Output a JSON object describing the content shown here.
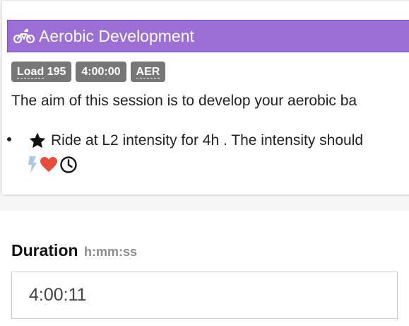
{
  "workout": {
    "title": "Aerobic Development",
    "header_color": "#9b6fd6",
    "header_icon": "bike-icon",
    "badges": [
      {
        "abbr": "Load",
        "value": "195"
      },
      {
        "abbr": "",
        "value": "4:00:00"
      },
      {
        "abbr": "AER",
        "value": ""
      }
    ],
    "description": "The aim of this session is to develop your aerobic ba",
    "steps": [
      {
        "icon": "star-icon",
        "text": "Ride at L2 intensity for 4h . The intensity should",
        "metric_icons": [
          "bolt-icon",
          "heart-icon",
          "clock-icon"
        ]
      }
    ]
  },
  "duration": {
    "label": "Duration",
    "hint": "h:mm:ss",
    "value": "4:00:11"
  },
  "colors": {
    "badge": "#777777",
    "heart": "#e74c3c",
    "bolt": "#a9c9e6"
  }
}
